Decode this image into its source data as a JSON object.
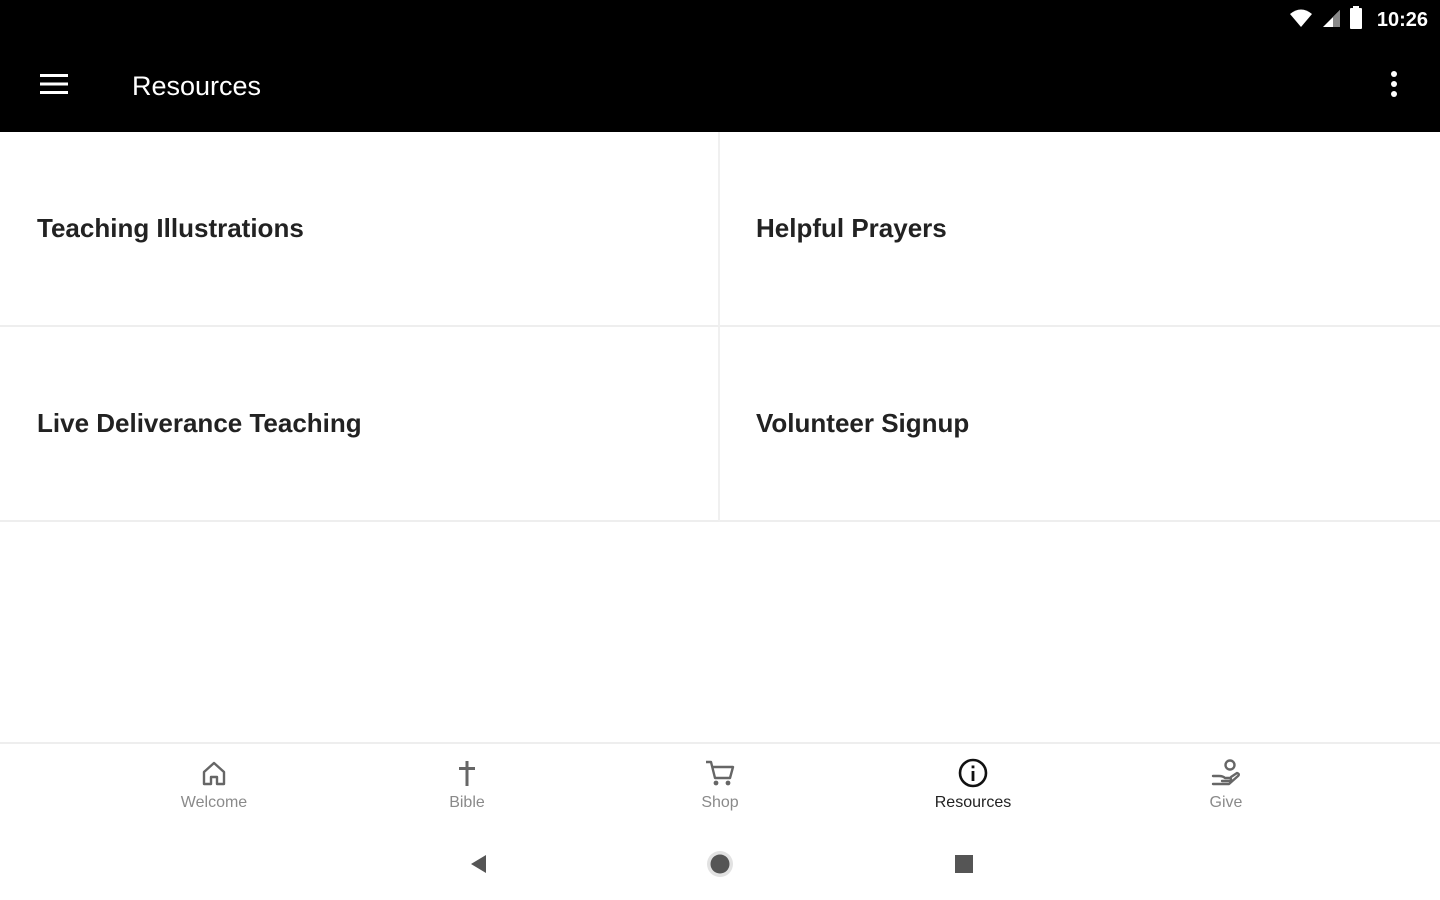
{
  "status_bar": {
    "time": "10:26",
    "icons": [
      "wifi-icon",
      "signal-icon",
      "battery-icon"
    ]
  },
  "app_bar": {
    "title": "Resources",
    "left_icon": "menu-icon",
    "right_icon": "overflow-menu-icon"
  },
  "tiles": [
    {
      "label": "Teaching Illustrations"
    },
    {
      "label": "Helpful Prayers"
    },
    {
      "label": "Live Deliverance Teaching"
    },
    {
      "label": "Volunteer Signup"
    }
  ],
  "bottom_nav": {
    "items": [
      {
        "label": "Welcome",
        "icon": "home-icon"
      },
      {
        "label": "Bible",
        "icon": "cross-icon"
      },
      {
        "label": "Shop",
        "icon": "cart-icon"
      },
      {
        "label": "Resources",
        "icon": "info-icon",
        "active": true
      },
      {
        "label": "Give",
        "icon": "give-hand-icon"
      }
    ]
  },
  "system_nav": {
    "buttons": [
      "back-icon",
      "home-circle-icon",
      "recents-icon"
    ]
  },
  "colors": {
    "app_bar_bg": "#000000",
    "text_primary": "#222222",
    "nav_inactive": "#8a8a8a",
    "divider": "#eeeeee"
  }
}
